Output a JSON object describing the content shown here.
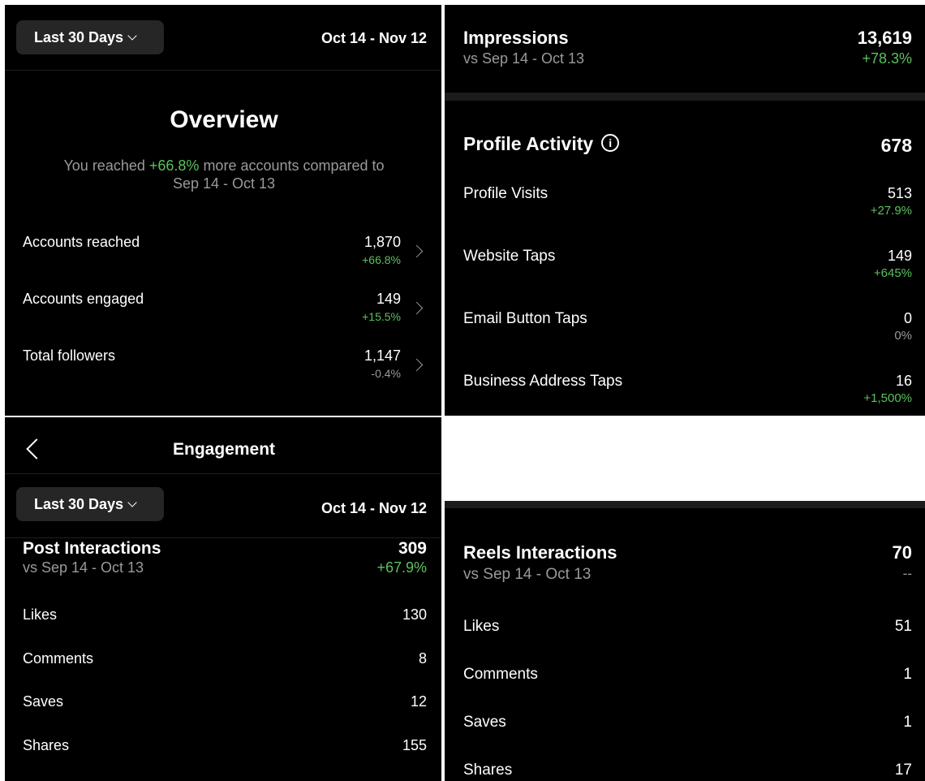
{
  "overview": {
    "range_button": "Last 30 Days",
    "date_range": "Oct 14 - Nov 12",
    "title": "Overview",
    "summary_prefix": "You reached ",
    "summary_pct": "+66.8%",
    "summary_suffix": " more accounts compared to",
    "summary_line2": "Sep 14 - Oct 13",
    "rows": [
      {
        "label": "Accounts reached",
        "value": "1,870",
        "change": "+66.8%"
      },
      {
        "label": "Accounts engaged",
        "value": "149",
        "change": "+15.5%"
      },
      {
        "label": "Total followers",
        "value": "1,147",
        "change": "-0.4%"
      }
    ]
  },
  "impressions": {
    "label": "Impressions",
    "compare": "vs Sep 14 - Oct 13",
    "value": "13,619",
    "change": "+78.3%"
  },
  "profile_activity": {
    "title": "Profile Activity",
    "info_glyph": "i",
    "total": "678",
    "rows": [
      {
        "label": "Profile Visits",
        "value": "513",
        "change": "+27.9%"
      },
      {
        "label": "Website Taps",
        "value": "149",
        "change": "+645%"
      },
      {
        "label": "Email Button Taps",
        "value": "0",
        "change": "0%"
      },
      {
        "label": "Business Address Taps",
        "value": "16",
        "change": "+1,500%"
      }
    ]
  },
  "engagement": {
    "header_title": "Engagement",
    "range_button": "Last 30 Days",
    "date_range": "Oct 14 - Nov 12",
    "post": {
      "title": "Post Interactions",
      "compare": "vs Sep 14 - Oct 13",
      "total": "309",
      "change": "+67.9%",
      "rows": [
        {
          "label": "Likes",
          "value": "130"
        },
        {
          "label": "Comments",
          "value": "8"
        },
        {
          "label": "Saves",
          "value": "12"
        },
        {
          "label": "Shares",
          "value": "155"
        }
      ]
    }
  },
  "reels": {
    "title": "Reels Interactions",
    "compare": "vs Sep 14 - Oct 13",
    "total": "70",
    "change": "--",
    "rows": [
      {
        "label": "Likes",
        "value": "51"
      },
      {
        "label": "Comments",
        "value": "1"
      },
      {
        "label": "Saves",
        "value": "1"
      },
      {
        "label": "Shares",
        "value": "17"
      }
    ]
  },
  "colors": {
    "positive": "#5ac15e",
    "muted": "#9a9a9a",
    "background": "#000000",
    "pill": "#262626"
  }
}
